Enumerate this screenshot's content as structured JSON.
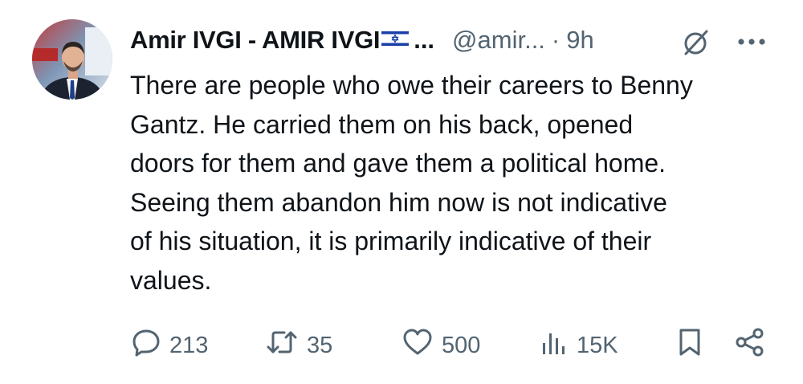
{
  "author": {
    "display_name": "Amir IVGI - AMIR IVGI",
    "truncation": "...",
    "handle": "@amir...",
    "separator": "·",
    "time": "9h"
  },
  "tweet": {
    "lines": [
      "There are people who owe their careers to Benny",
      "Gantz. He carried them on his back, opened",
      "doors for them and gave them a political home.",
      "Seeing them abandon him now is not indicative",
      "of his situation, it is primarily indicative of their",
      "values."
    ]
  },
  "actions": {
    "replies": "213",
    "reposts": "35",
    "likes": "500",
    "views": "15K"
  },
  "icons": {
    "reply": "speech-bubble-icon",
    "repost": "repost-arrows-icon",
    "like": "heart-icon",
    "views": "bar-chart-icon",
    "bookmark": "bookmark-icon",
    "share": "share-icon",
    "grok": "grok-icon",
    "more": "more-dots-icon",
    "flag": "israel-flag-icon"
  },
  "colors": {
    "text": "#0f1419",
    "secondary": "#536471",
    "flag_blue": "#1a3fa8"
  }
}
